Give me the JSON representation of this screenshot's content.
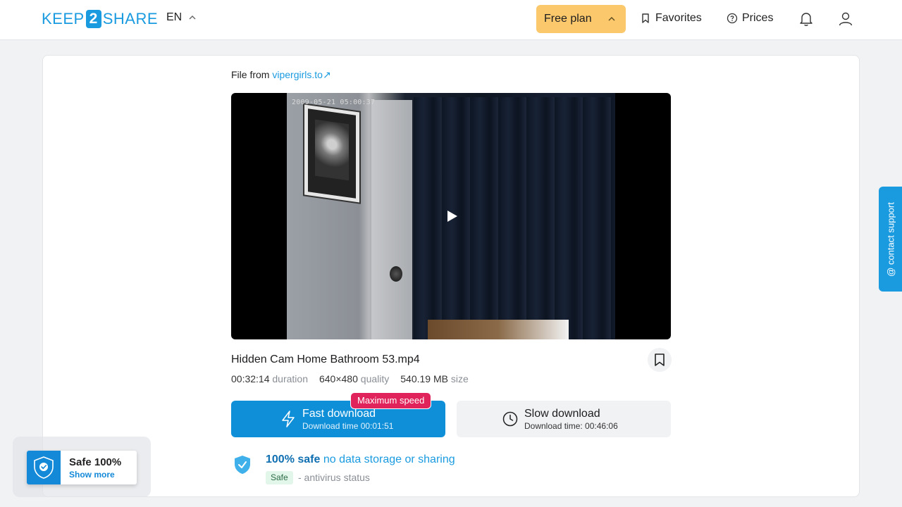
{
  "header": {
    "logo": {
      "left": "KEEP",
      "digit": "2",
      "right": "SHARE"
    },
    "language": "EN",
    "plan_label": "Free plan",
    "favorites_label": "Favorites",
    "prices_label": "Prices"
  },
  "file": {
    "from_prefix": "File from",
    "source": "vipergirls.to",
    "source_arrow": "↗",
    "video_timestamp": "2009-05-21  05:00:37",
    "name": "Hidden Cam Home Bathroom 53.mp4",
    "duration": "00:32:14",
    "duration_label": "duration",
    "quality": "640×480",
    "quality_label": "quality",
    "size": "540.19 MB",
    "size_label": "size"
  },
  "downloads": {
    "fast": {
      "title": "Fast download",
      "subtitle": "Download time 00:01:51",
      "badge": "Maximum speed"
    },
    "slow": {
      "title": "Slow download",
      "subtitle": "Download time: 00:46:06"
    }
  },
  "safety": {
    "strong": "100% safe",
    "rest": "no data storage or sharing",
    "tag": "Safe",
    "status": "- antivirus status"
  },
  "safe_widget": {
    "title": "Safe 100%",
    "link": "Show more"
  },
  "support": {
    "label": "@ contact support"
  },
  "colors": {
    "accent": "#1a9be0",
    "fast_button": "#0f8fd8",
    "badge": "#e0235a",
    "plan": "#fcc86c"
  }
}
